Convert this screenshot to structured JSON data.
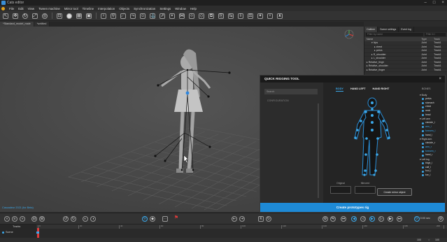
{
  "window": {
    "title": "Cats editor"
  },
  "menu": [
    "File",
    "Edit",
    "View",
    "Tween machine",
    "Mirror tool",
    "Timeline",
    "Interpolation",
    "Objects",
    "Synchronization",
    "Settings",
    "Window",
    "Help"
  ],
  "doc_tabs": [
    "*Standard_model_male",
    "*untitled"
  ],
  "viewport": {
    "footer": "Cascadeur 2021 (for Beta)"
  },
  "outliner": {
    "tabs": [
      "Outliner",
      "Scene settings",
      "Event log"
    ],
    "filter_name": "Filter by name",
    "filter_type": "Filter b t",
    "columns": [
      "Name",
      "Type",
      "Track"
    ],
    "rows": [
      {
        "name": "▾ hips",
        "type": "Joint",
        "track": "Track1"
      },
      {
        "name": "▸ chest",
        "type": "Joint",
        "track": "Track1"
      },
      {
        "name": "▸ pelvis",
        "type": "Joint",
        "track": "Track1"
      },
      {
        "name": "▸ R_shoulder",
        "type": "Joint",
        "track": "Track1"
      },
      {
        "name": "▸ L_shoulder",
        "type": "Joint",
        "track": "Track1"
      },
      {
        "name": "▸ Relative_thigh",
        "type": "Joint",
        "track": "Track1"
      },
      {
        "name": "▸ Relative_shoulder",
        "type": "Joint",
        "track": "Track1"
      },
      {
        "name": "▸ Relative_finger",
        "type": "Joint",
        "track": "Track1"
      }
    ]
  },
  "qrt": {
    "title": "QUICK RIGGING TOOL",
    "search_placeholder": "Search",
    "configuration": "CONFIGURATION",
    "tabs": [
      "BODY",
      "HAND LEFT",
      "HAND RIGHT"
    ],
    "bones_title": "BONES",
    "groups": [
      {
        "label": "▾ Body",
        "items": [
          "pelvis",
          "stomach",
          "chest",
          "neck",
          "head"
        ]
      },
      {
        "label": "▾ Left arm",
        "items": [
          "clavicle_l",
          "arm_l",
          "forearm_l",
          "hand_l"
        ]
      },
      {
        "label": "▾ Right arm",
        "items": [
          "clavicle_r",
          "arm_r",
          "forearm_r",
          "hand_r"
        ]
      },
      {
        "label": "▾ Left leg",
        "items": [
          "thigh_l",
          "calf_l",
          "foot_l",
          "toe_l"
        ]
      }
    ],
    "slots": [
      "Original",
      "Mirrored"
    ],
    "create_mirror": "Create mirror object",
    "create_button": "Create prototypes rig"
  },
  "transport": {
    "timecode": "0:00 sec"
  },
  "timeline": {
    "tracks_label": "Tracks",
    "track_name": "Scene",
    "ticks": [
      "0",
      "20",
      "40",
      "60",
      "80",
      "100",
      "120",
      "140",
      "160",
      "180",
      "200"
    ],
    "frame_value": "100",
    "frame_end": "100"
  },
  "colors": {
    "accent": "#1e8ad6",
    "skeleton": "#3ba7e8",
    "record": "#e03b3b"
  }
}
